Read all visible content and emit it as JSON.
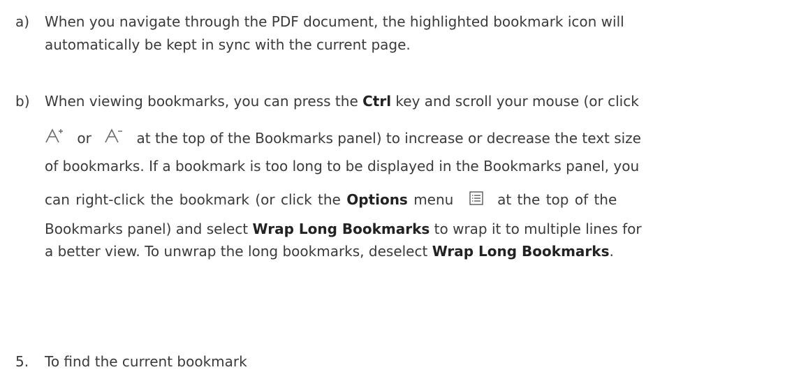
{
  "items": [
    {
      "marker": "a)",
      "line1": "When you navigate through the PDF document, the highlighted bookmark icon will",
      "line2": "automatically be kept in sync with the current page."
    },
    {
      "marker": "b)",
      "line1": {
        "pre": "When viewing bookmarks, you can press the ",
        "b1": "Ctrl",
        "post": " key and scroll your mouse (or click"
      },
      "line2": {
        "or": "or",
        "post": "at the top of the Bookmarks panel) to increase or decrease the text size"
      },
      "line3": "of bookmarks. If a bookmark is too long to be displayed in the Bookmarks panel, you",
      "line4": {
        "pre": "can right-click the bookmark (or click the ",
        "b1": "Options",
        "mid": " menu",
        "post": "at the top of the"
      },
      "line5": {
        "pre": "Bookmarks panel) and select ",
        "b1": "Wrap Long Bookmarks",
        "post": " to wrap it to multiple lines for"
      },
      "line6": {
        "pre": "a better view. To unwrap the long bookmarks, deselect ",
        "b1": "Wrap Long Bookmarks",
        "post": "."
      }
    },
    {
      "marker": "5.",
      "line1": "To find the current bookmark"
    }
  ],
  "icons": {
    "increase": "font-increase-icon",
    "decrease": "font-decrease-icon",
    "options": "options-menu-icon"
  }
}
